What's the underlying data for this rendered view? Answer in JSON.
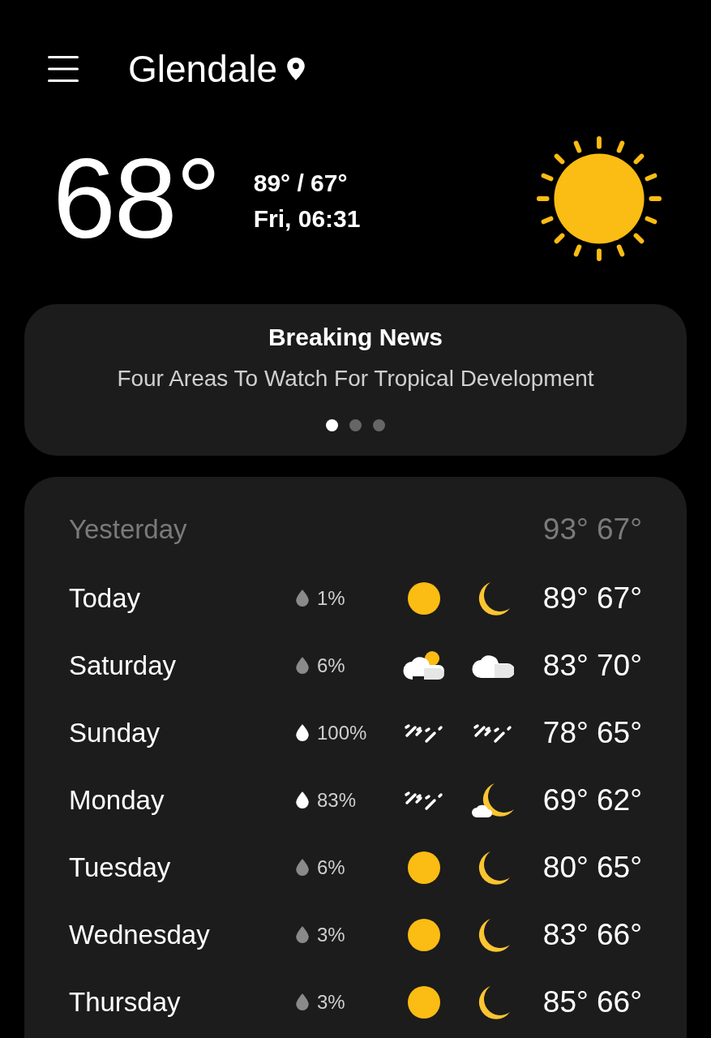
{
  "header": {
    "location": "Glendale"
  },
  "current": {
    "temperature": "68°",
    "high_low": "89° / 67°",
    "datetime": "Fri, 06:31",
    "condition": {
      "kind": "sun"
    }
  },
  "news": {
    "heading": "Breaking News",
    "headline": "Four Areas To Watch For Tropical Development",
    "pages": [
      {
        "selected": true
      },
      {
        "selected": false
      },
      {
        "selected": false
      }
    ]
  },
  "yesterday": {
    "label": "Yesterday",
    "temps": "93° 67°"
  },
  "forecast": [
    {
      "day": "Today",
      "precip": "1%",
      "high_chance": false,
      "day_icon": {
        "kind": "sun"
      },
      "night_icon": {
        "kind": "moon"
      },
      "temps": "89° 67°"
    },
    {
      "day": "Saturday",
      "precip": "6%",
      "high_chance": false,
      "day_icon": {
        "kind": "partly-cloudy"
      },
      "night_icon": {
        "kind": "cloud"
      },
      "temps": "83° 70°"
    },
    {
      "day": "Sunday",
      "precip": "100%",
      "high_chance": true,
      "day_icon": {
        "kind": "rain"
      },
      "night_icon": {
        "kind": "rain"
      },
      "temps": "78° 65°"
    },
    {
      "day": "Monday",
      "precip": "83%",
      "high_chance": true,
      "day_icon": {
        "kind": "rain"
      },
      "night_icon": {
        "kind": "moon-cloud"
      },
      "temps": "69° 62°"
    },
    {
      "day": "Tuesday",
      "precip": "6%",
      "high_chance": false,
      "day_icon": {
        "kind": "sun"
      },
      "night_icon": {
        "kind": "moon"
      },
      "temps": "80° 65°"
    },
    {
      "day": "Wednesday",
      "precip": "3%",
      "high_chance": false,
      "day_icon": {
        "kind": "sun"
      },
      "night_icon": {
        "kind": "moon"
      },
      "temps": "83° 66°"
    },
    {
      "day": "Thursday",
      "precip": "3%",
      "high_chance": false,
      "day_icon": {
        "kind": "sun"
      },
      "night_icon": {
        "kind": "moon"
      },
      "temps": "85° 66°"
    }
  ]
}
